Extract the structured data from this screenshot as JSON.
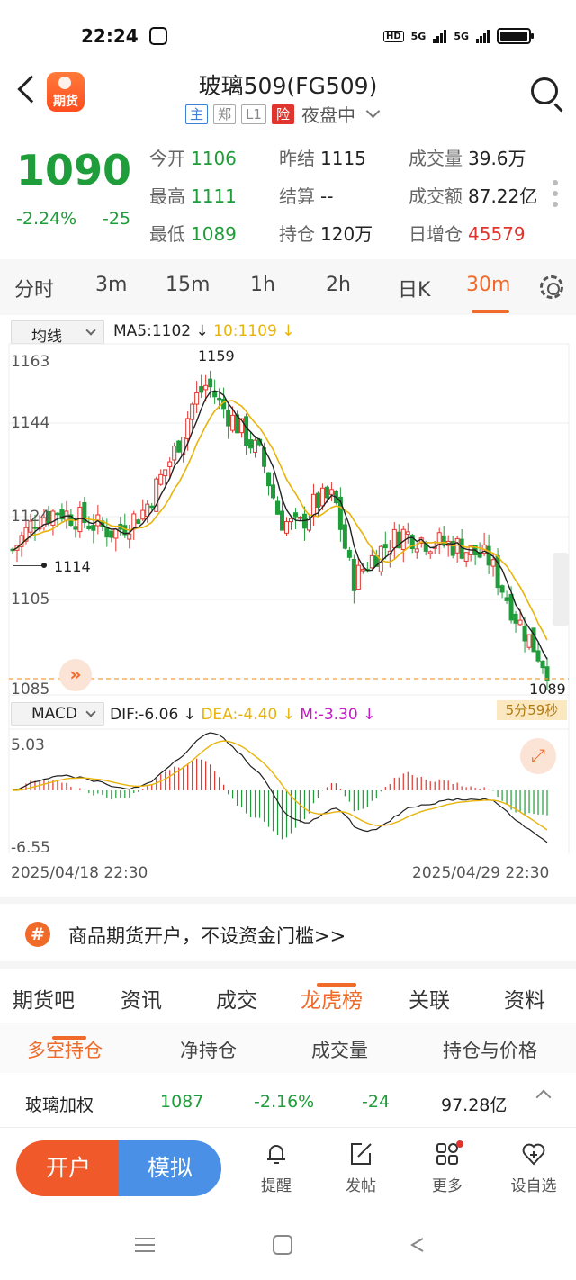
{
  "status": {
    "time": "22:24",
    "hd": "HD",
    "net1": "5G",
    "net2": "5G"
  },
  "header": {
    "back_icon": "back-arrow-icon",
    "logo_text": "期货",
    "title": "玻璃509(FG509)",
    "tags": [
      "主",
      "郑",
      "L1",
      "险"
    ],
    "session": "夜盘中",
    "search_icon": "search-icon"
  },
  "quote": {
    "price": "1090",
    "change_pct": "-2.24%",
    "change": "-25",
    "fields": [
      {
        "k": "今开",
        "v": "1106",
        "tone": "g"
      },
      {
        "k": "昨结",
        "v": "1115",
        "tone": "dk"
      },
      {
        "k": "成交量",
        "v": "39.6万",
        "tone": "dk"
      },
      {
        "k": "最高",
        "v": "1111",
        "tone": "g"
      },
      {
        "k": "结算",
        "v": "--",
        "tone": "dk"
      },
      {
        "k": "成交额",
        "v": "87.22亿",
        "tone": "dk"
      },
      {
        "k": "最低",
        "v": "1089",
        "tone": "g"
      },
      {
        "k": "持仓",
        "v": "120万",
        "tone": "dk"
      },
      {
        "k": "日增仓",
        "v": "45579",
        "tone": "r"
      }
    ]
  },
  "tabs": {
    "items": [
      "分时",
      "3m",
      "15m",
      "1h",
      "2h",
      "日K",
      "30m"
    ],
    "active": "30m"
  },
  "chart_labels": {
    "ma_select": "均线",
    "ma5": "MA5:1102",
    "ma10": "10:1109",
    "y_ticks": [
      "1163",
      "1144",
      "1124",
      "1105",
      "1085"
    ],
    "high_label": "1159",
    "left_mark": "1114",
    "last_price": "1089",
    "countdown": "5分59秒",
    "macd_select": "MACD",
    "dif": "DIF:-6.06",
    "dea": "DEA:-4.40",
    "m": "M:-3.30",
    "macd_top": "5.03",
    "macd_bottom": "-6.55",
    "date_start": "2025/04/18 22:30",
    "date_end": "2025/04/29 22:30"
  },
  "chart_data": {
    "type": "candlestick",
    "interval": "30m",
    "ylim": [
      1085,
      1163
    ],
    "high": 1159,
    "last": 1089,
    "ma5": 1102,
    "ma10": 1109,
    "macd": {
      "dif": -6.06,
      "dea": -4.4,
      "m": -3.3,
      "range": [
        -6.55,
        5.03
      ]
    },
    "x_start": "2025/04/18 22:30",
    "x_end": "2025/04/29 22:30",
    "colors": {
      "up": "#e0352f",
      "down": "#1f9d3a",
      "ma5": "#222222",
      "ma10": "#e8b40c"
    }
  },
  "promo": {
    "text": "商品期货开户，不设资金门槛>>"
  },
  "nav": {
    "items": [
      "期货吧",
      "资讯",
      "成交",
      "龙虎榜",
      "关联",
      "资料"
    ],
    "active": "龙虎榜"
  },
  "subnav": {
    "items": [
      "多空持仓",
      "净持仓",
      "成交量",
      "持仓与价格"
    ],
    "active": "多空持仓"
  },
  "index_row": {
    "name": "玻璃加权",
    "price": "1087",
    "pct": "-2.16%",
    "chg": "-24",
    "amount": "97.28亿"
  },
  "bottom": {
    "open": "开户",
    "sim": "模拟",
    "items": [
      {
        "label": "提醒",
        "icon": "bell-icon"
      },
      {
        "label": "发帖",
        "icon": "edit-icon"
      },
      {
        "label": "更多",
        "icon": "grid-icon"
      },
      {
        "label": "设自选",
        "icon": "heart-add-icon"
      }
    ]
  }
}
